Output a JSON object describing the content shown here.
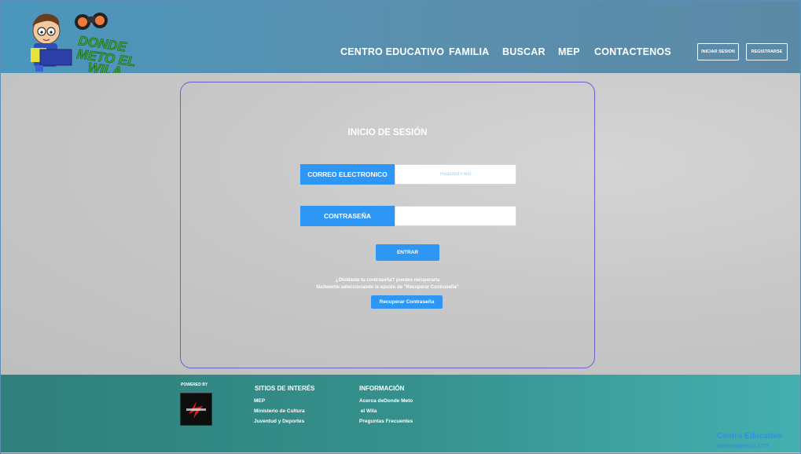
{
  "header": {
    "logo_lines": [
      "DONDE",
      "METO EL",
      "WILA"
    ],
    "nav": [
      "CENTRO EDUCATIVO",
      "FAMILIA",
      "BUSCAR",
      "MEP",
      "CONTACTENOS"
    ],
    "login_button": "INICIAR SESION",
    "register_button": "REGISTRARSE"
  },
  "login": {
    "title": "INICIO DE SESIÓN",
    "email_label": "CORREO ELECTRONICO",
    "email_placeholder": "Required Field",
    "password_label": "CONTRASEÑA",
    "password_value": "",
    "submit_label": "ENTRAR",
    "forgot_line1": "¿Olvidaste tu contraseña? puedes recuperarla",
    "forgot_line2": "fácilmente seleccionando la opción de \"Recuperar Contraseña\"",
    "recover_label": "Recuperar Contraseña"
  },
  "footer": {
    "powered_by": "POWERED BY",
    "sites_title": "SITIOS DE INTERÉS",
    "sites": [
      "MEP",
      "Ministerio de Cultura",
      "Juventud y Deportes"
    ],
    "info_title": "INFORMACIÓN",
    "info": [
      "Acerca deDonde Meto",
      " el Wila",
      "Preguntas Frecuentes"
    ],
    "brand_line1": "Centro Educativo",
    "brand_line2": "DEPENDENCIA LTD"
  },
  "colors": {
    "accent": "#2e96f5",
    "card_border": "#6a5fc8",
    "footer_teal": "#35908c",
    "header_blue": "#4a97bd"
  }
}
